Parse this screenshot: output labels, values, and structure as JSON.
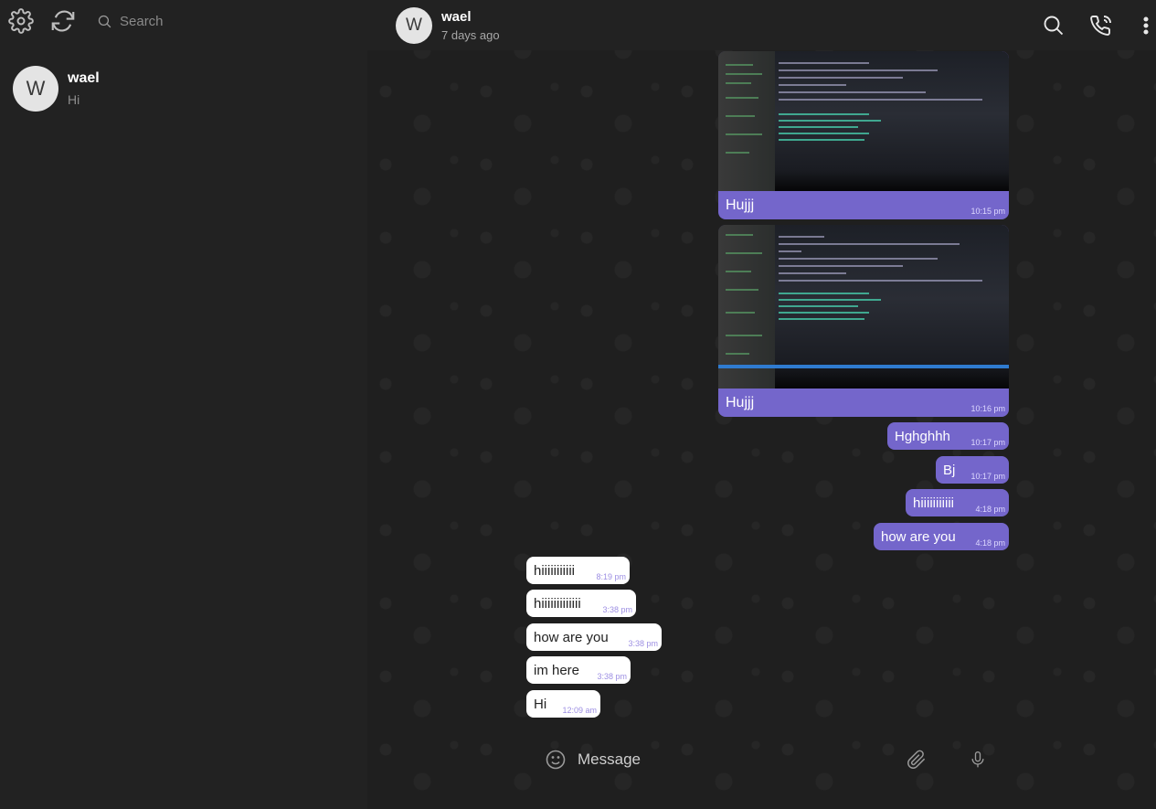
{
  "sidebar": {
    "search_placeholder": "Search",
    "icons": {
      "settings": "gear-icon",
      "refresh": "refresh-icon",
      "search": "search-icon"
    },
    "chats": [
      {
        "avatar_letter": "W",
        "name": "wael",
        "preview": "Hi"
      }
    ]
  },
  "header": {
    "avatar_letter": "W",
    "name": "wael",
    "status": "7 days ago",
    "icons": {
      "search": "search-icon",
      "call": "phone-call-icon",
      "menu": "more-vertical-icon"
    }
  },
  "messages": [
    {
      "direction": "out",
      "type": "image",
      "caption": "Hujjj",
      "time": "10:15 pm"
    },
    {
      "direction": "out",
      "type": "image",
      "caption": "Hujjj",
      "time": "10:16 pm"
    },
    {
      "direction": "out",
      "type": "text",
      "text": "Hghghhh",
      "time": "10:17 pm"
    },
    {
      "direction": "out",
      "type": "text",
      "text": "Bj",
      "time": "10:17 pm"
    },
    {
      "direction": "out",
      "type": "text",
      "text": "hiiiiiiiiiii",
      "time": "4:18 pm"
    },
    {
      "direction": "out",
      "type": "text",
      "text": "how are you",
      "time": "4:18 pm"
    },
    {
      "direction": "in",
      "type": "text",
      "text": "hiiiiiiiiiii",
      "time": "8:19 pm"
    },
    {
      "direction": "in",
      "type": "text",
      "text": "hiiiiiiiiiiiii",
      "time": "3:38 pm"
    },
    {
      "direction": "in",
      "type": "text",
      "text": "how are you",
      "time": "3:38 pm"
    },
    {
      "direction": "in",
      "type": "text",
      "text": "im here",
      "time": "3:38 pm"
    },
    {
      "direction": "in",
      "type": "text",
      "text": "Hi",
      "time": "12:09 am"
    }
  ],
  "composer": {
    "placeholder": "Message",
    "icons": {
      "emoji": "emoji-icon",
      "attach": "paperclip-icon",
      "mic": "microphone-icon"
    }
  },
  "colors": {
    "background": "#222222",
    "outgoing_bubble": "#7466cb",
    "incoming_bubble": "#ffffff",
    "incoming_time": "#9d8fe3"
  }
}
